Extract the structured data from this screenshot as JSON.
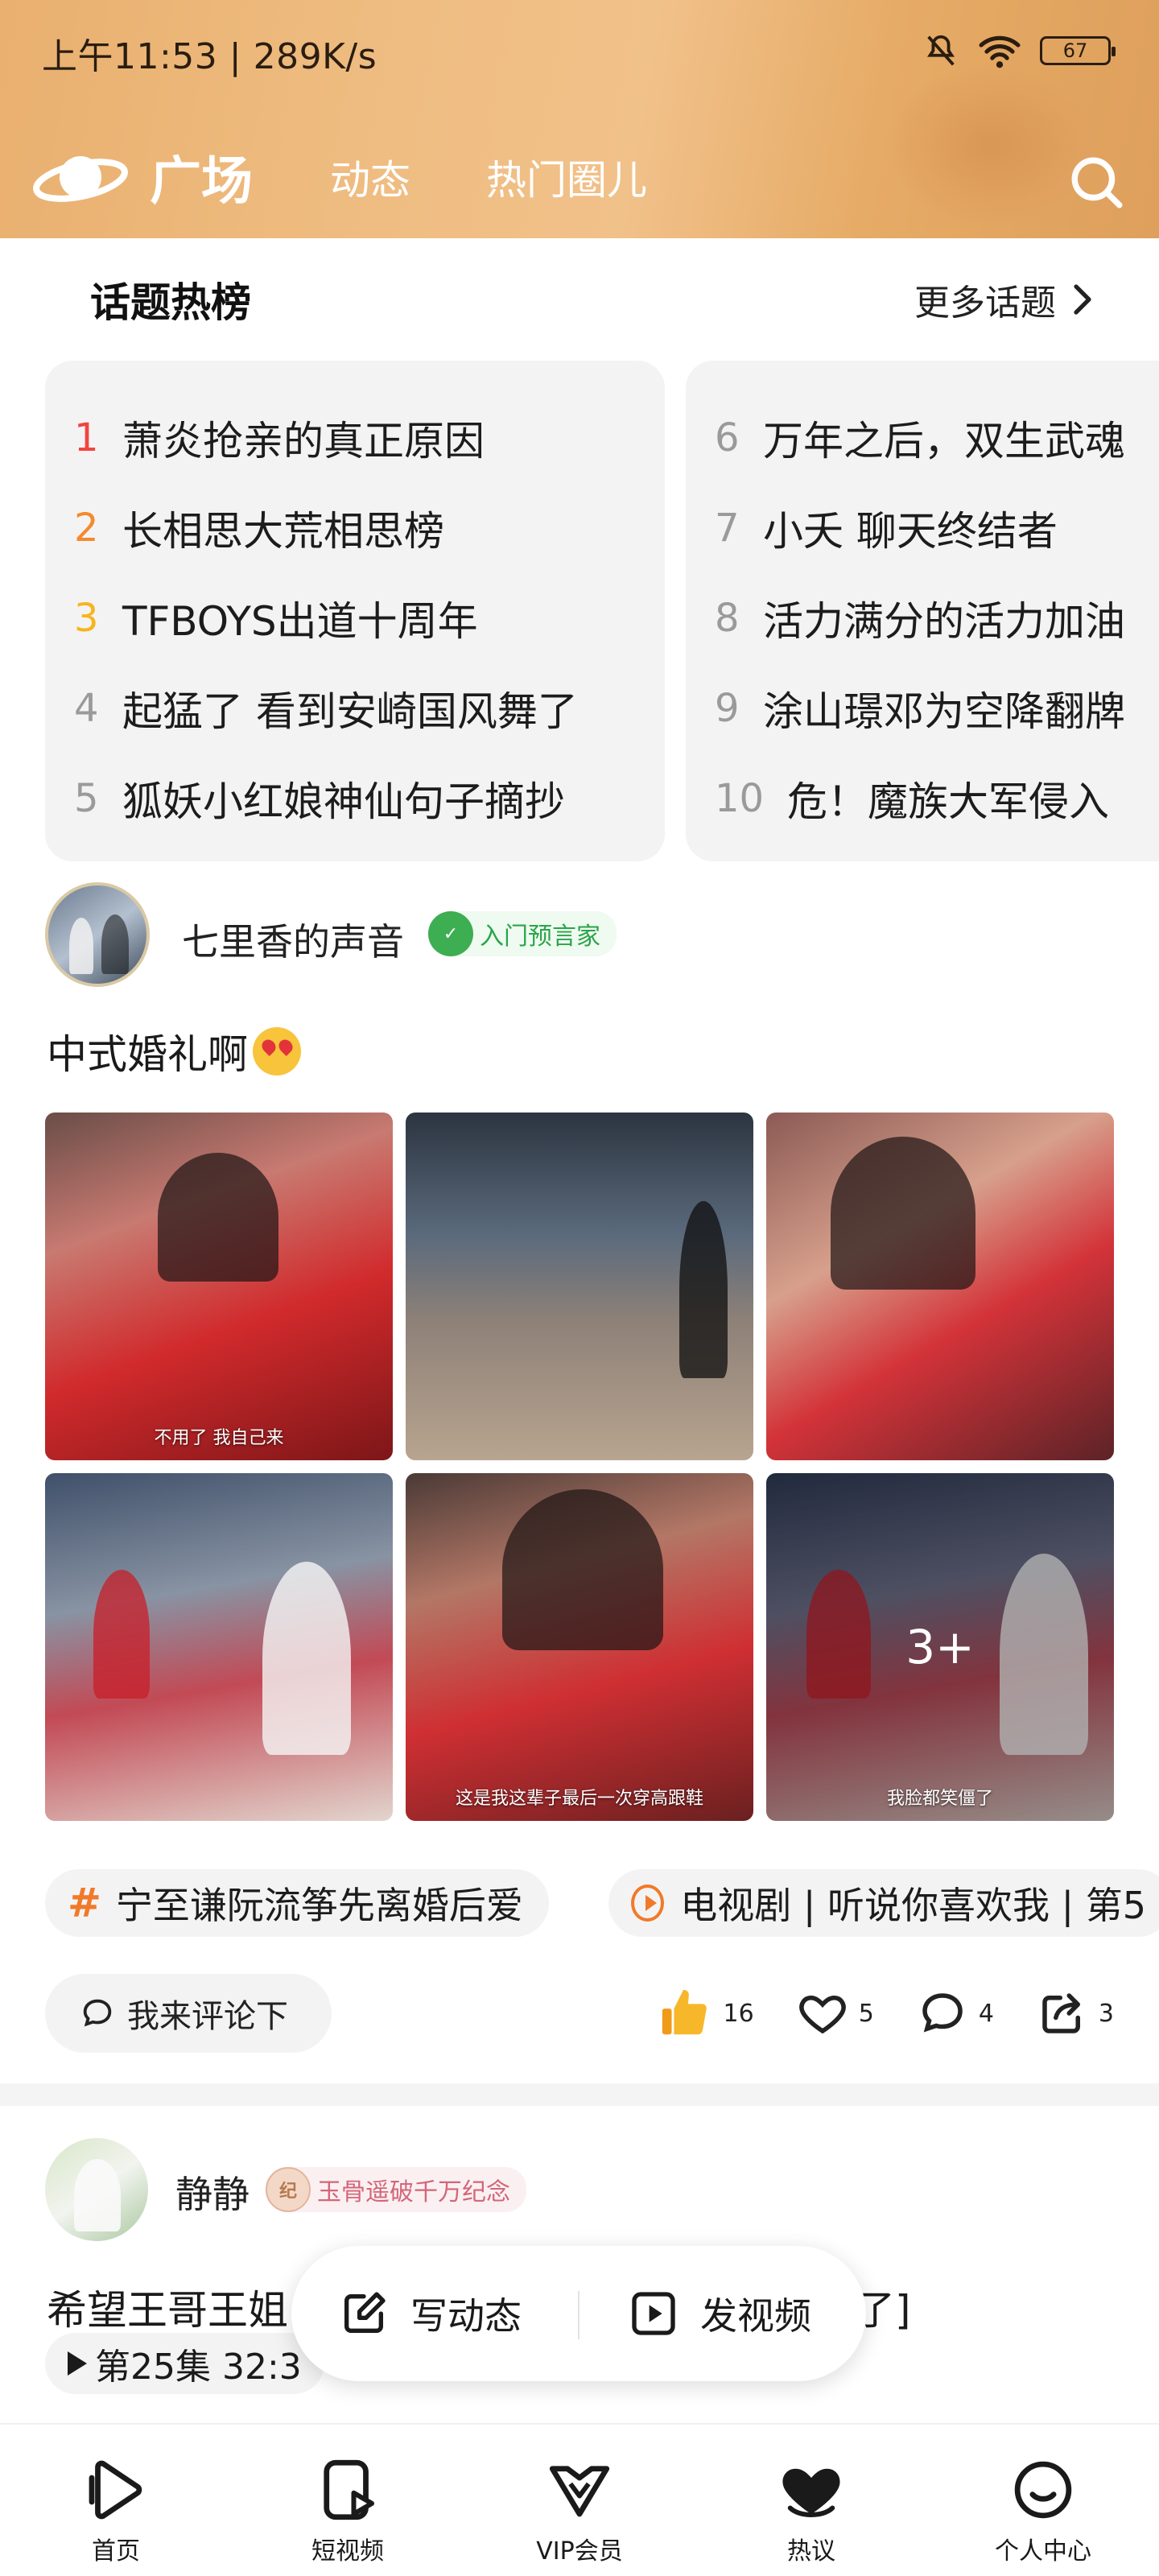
{
  "status": {
    "time": "上午11:53 | 289K/s",
    "battery": "67"
  },
  "nav": {
    "tabs": [
      {
        "label": "广场"
      },
      {
        "label": "动态"
      },
      {
        "label": "热门圈儿"
      }
    ]
  },
  "topics": {
    "title": "话题热榜",
    "more": "更多话题",
    "left": [
      {
        "rank": "1",
        "text": "萧炎抢亲的真正原因"
      },
      {
        "rank": "2",
        "text": "长相思大荒相思榜"
      },
      {
        "rank": "3",
        "text": "TFBOYS出道十周年"
      },
      {
        "rank": "4",
        "text": "起猛了 看到安崎国风舞了"
      },
      {
        "rank": "5",
        "text": "狐妖小红娘神仙句子摘抄"
      }
    ],
    "right": [
      {
        "rank": "6",
        "text": "万年之后，双生武魂"
      },
      {
        "rank": "7",
        "text": "小夭 聊天终结者"
      },
      {
        "rank": "8",
        "text": "活力满分的活力加油"
      },
      {
        "rank": "9",
        "text": "涂山璟邓为空降翻牌"
      },
      {
        "rank": "10",
        "text": "危！魔族大军侵入"
      }
    ]
  },
  "post1": {
    "user": "七里香的声音",
    "badge": "入门预言家",
    "text": "中式婚礼啊",
    "images": [
      {
        "subtitle": "不用了 我自己来"
      },
      {
        "subtitle": ""
      },
      {
        "subtitle": ""
      },
      {
        "subtitle": ""
      },
      {
        "subtitle": "这是我这辈子最后一次穿高跟鞋"
      },
      {
        "subtitle": "我脸都笑僵了",
        "more": "3+"
      }
    ],
    "tags": [
      "宁至谦阮流筝先离婚后爱",
      "电视剧 | 听说你喜欢我 | 第5"
    ],
    "comment_placeholder": "我来评论下",
    "counts": {
      "likes": "16",
      "favorites": "5",
      "comments": "4",
      "shares": "3"
    }
  },
  "post2": {
    "user": "静静",
    "badge": "玉骨遥破千万纪念",
    "text_start": "希望王哥王姐",
    "text_end": "了]",
    "episode": "第25集 32:3"
  },
  "floating": {
    "write": "写动态",
    "video": "发视频"
  },
  "tabbar": [
    {
      "label": "首页"
    },
    {
      "label": "短视频"
    },
    {
      "label": "VIP会员"
    },
    {
      "label": "热议"
    },
    {
      "label": "个人中心"
    }
  ],
  "colors": {
    "accent": "#f07a2a",
    "rank1": "#f2453d",
    "rank2": "#f48a2c",
    "rank3": "#f6b51f",
    "header": "#eab474"
  }
}
